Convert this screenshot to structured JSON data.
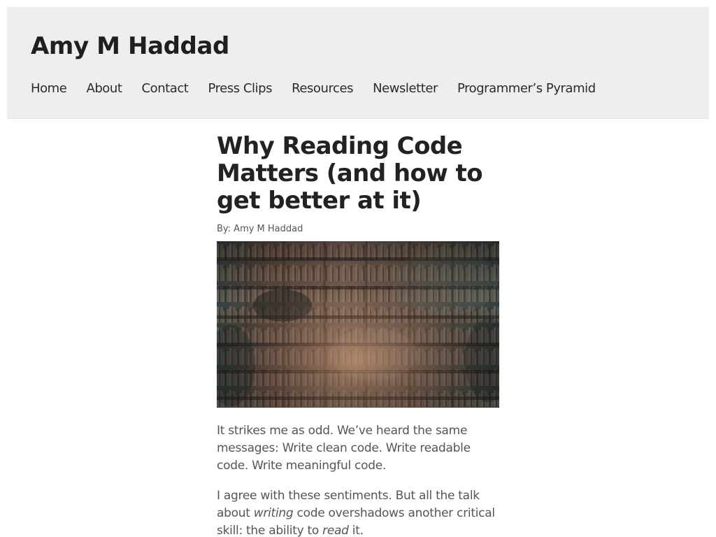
{
  "site": {
    "title": "Amy M Haddad"
  },
  "nav": {
    "items": [
      {
        "label": "Home"
      },
      {
        "label": "About"
      },
      {
        "label": "Contact"
      },
      {
        "label": "Press Clips"
      },
      {
        "label": "Resources"
      },
      {
        "label": "Newsletter"
      },
      {
        "label": "Programmer’s Pyramid"
      }
    ]
  },
  "article": {
    "title": "Why Reading Code Matters (and how to get better at it)",
    "byline": "By: Amy M Haddad",
    "paragraph_1": "It strikes me as odd. We’ve heard the same messages: Write clean code. Write readable code. Write meaningful code.",
    "paragraph_2": {
      "part_1": "I agree with these sentiments. But all the talk about ",
      "emphasis_1": "writing",
      "part_2": " code overshadows another critical skill: the ability to ",
      "emphasis_2": "read",
      "part_3": " it."
    }
  },
  "colors": {
    "header_background": "#eeeeee",
    "site_title": "#1f1f1f",
    "body_text": "#555555",
    "heading_text": "#222222"
  }
}
